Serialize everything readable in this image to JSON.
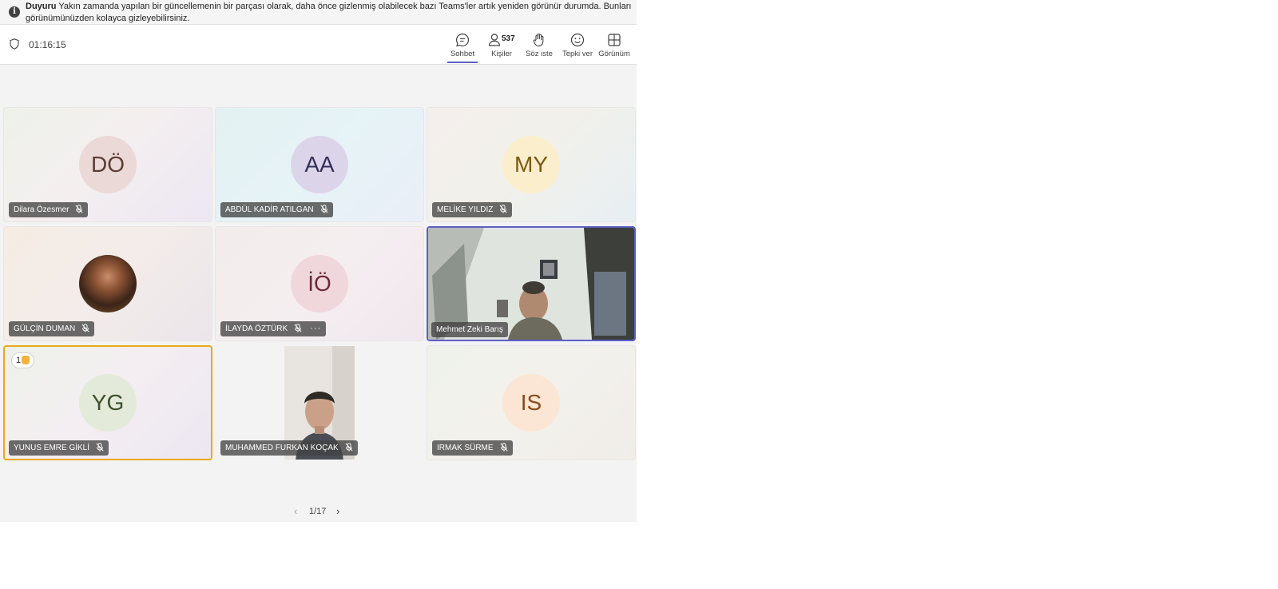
{
  "banner": {
    "title": "Duyuru",
    "text_line1": "Yakın zamanda yapılan bir güncellemenin bir parçası olarak, daha önce gizlenmiş olabilecek bazı Teams'ler artık yeniden görünür durumda. Bunları",
    "text_line2": "görünümünüzden kolayca gizleyebilirsiniz."
  },
  "topbar": {
    "timer": "01:16:15",
    "buttons": [
      {
        "label": "Sohbet",
        "icon": "chat-icon",
        "active": true
      },
      {
        "label": "Kişiler",
        "icon": "people-icon",
        "count": "537"
      },
      {
        "label": "Söz iste",
        "icon": "raise-hand-icon"
      },
      {
        "label": "Tepki ver",
        "icon": "emoji-icon"
      },
      {
        "label": "Görünüm",
        "icon": "grid-view-icon"
      }
    ]
  },
  "participants": [
    {
      "name": "Dilara Özesmer",
      "initials": "DÖ",
      "muted": true
    },
    {
      "name": "ABDÜL KADİR ATILGAN",
      "initials": "AA",
      "muted": true
    },
    {
      "name": "MELİKE YILDIZ",
      "initials": "MY",
      "muted": true
    },
    {
      "name": "GÜLÇİN DUMAN",
      "initials": "",
      "muted": true,
      "photo": true
    },
    {
      "name": "İLAYDA ÖZTÜRK",
      "initials": "İÖ",
      "muted": true,
      "more": "···"
    },
    {
      "name": "Mehmet Zeki Barış",
      "initials": "",
      "video": true,
      "speaking": true
    },
    {
      "name": "YUNUS EMRE GİKLİ",
      "initials": "YG",
      "muted": true,
      "raised_hand": "1"
    },
    {
      "name": "MUHAMMED FURKAN KOÇAK",
      "initials": "",
      "muted": true,
      "video": true
    },
    {
      "name": "IRMAK SÜRME",
      "initials": "IS",
      "muted": true
    }
  ],
  "pager": {
    "label": "1/17"
  },
  "colors": {
    "accent": "#5b5fc7",
    "raised_hand_border": "#e8a919",
    "avatar_DO_bg": "#ead9d6",
    "avatar_DO_fg": "#5c3b34",
    "avatar_AA_bg": "#dcd5ea",
    "avatar_AA_fg": "#35305c",
    "avatar_MY_bg": "#fbeecd",
    "avatar_MY_fg": "#7a5a12",
    "avatar_IO_bg": "#efd7dc",
    "avatar_IO_fg": "#6b2a36",
    "avatar_YG_bg": "#e3ead9",
    "avatar_YG_fg": "#3d4f2b",
    "avatar_IS_bg": "#fbe6d5",
    "avatar_IS_fg": "#8a4a1c"
  }
}
